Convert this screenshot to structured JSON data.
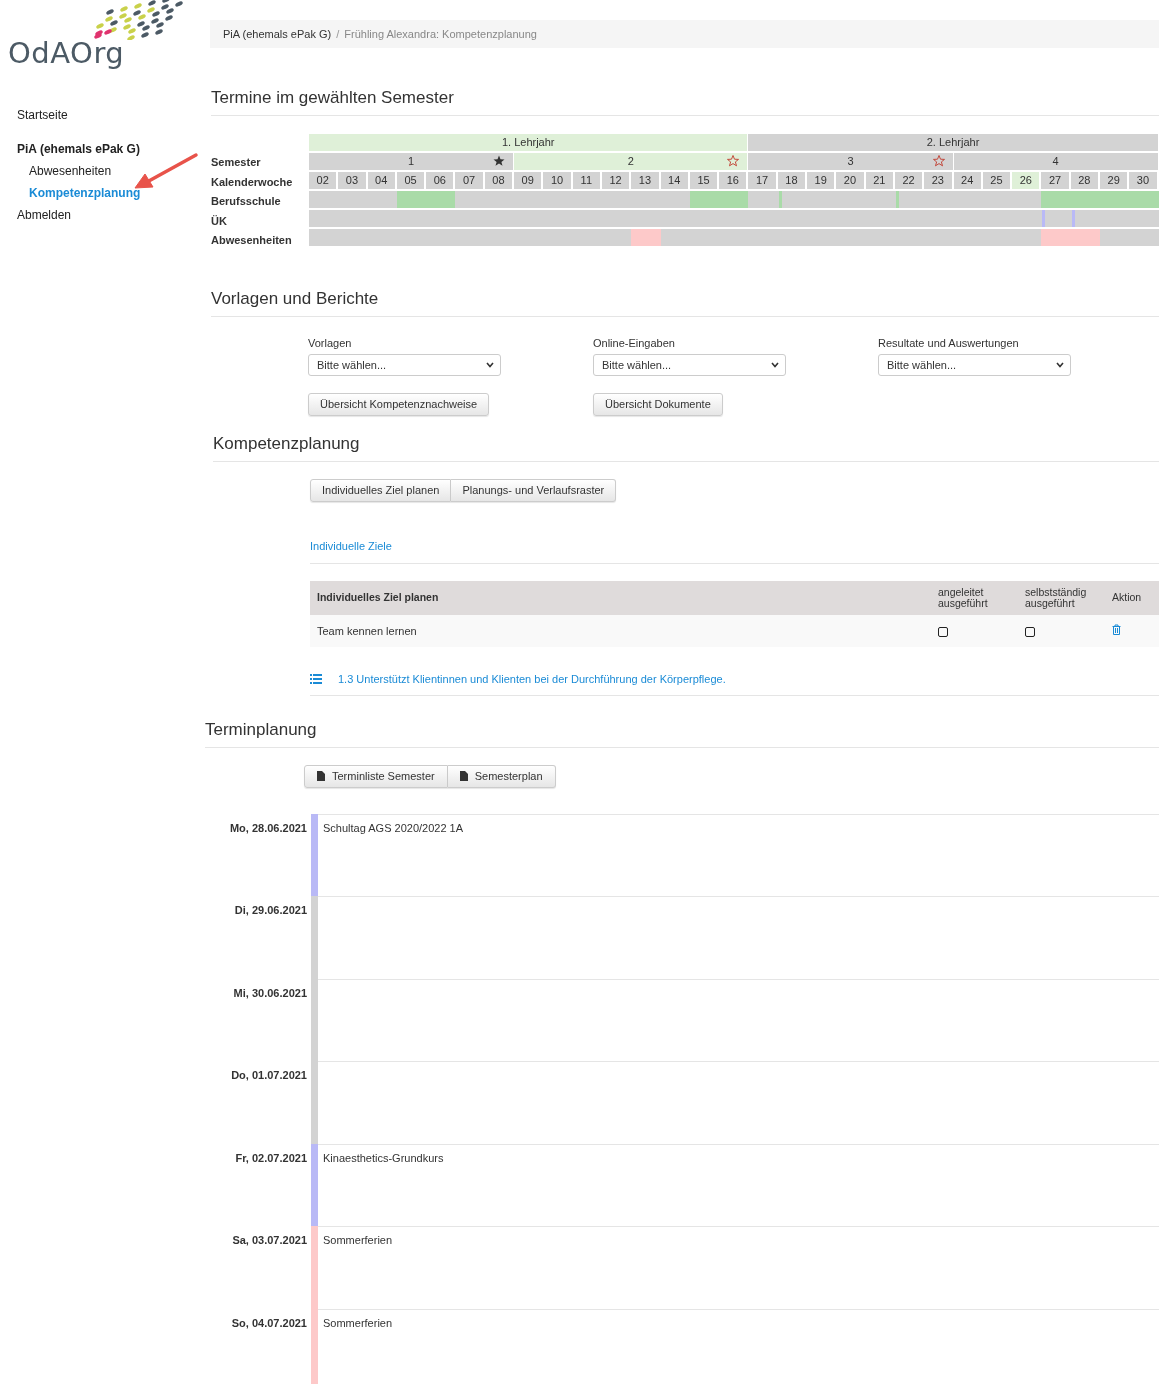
{
  "logo": {
    "text": "OdAOrg"
  },
  "sidebar": {
    "items": [
      {
        "label": "Startseite",
        "selected": false
      },
      {
        "label": "PiA (ehemals ePak G)",
        "selected": false,
        "children": [
          {
            "label": "Abwesenheiten",
            "selected": false
          },
          {
            "label": "Kompetenzplanung",
            "selected": true
          }
        ]
      },
      {
        "label": "Abmelden",
        "selected": false
      }
    ]
  },
  "breadcrumb": [
    {
      "label": "PiA (ehemals ePak G)",
      "kind": "link"
    },
    {
      "label": "/",
      "kind": "separator"
    },
    {
      "label": "Frühling Alexandra: Kompetenzplanung",
      "kind": "current"
    }
  ],
  "timeline": {
    "title": "Termine im gewählten Semester",
    "row_labels": [
      "Semester",
      "Kalenderwoche",
      "Berufsschule",
      "ÜK",
      "Abwesenheiten"
    ],
    "lehrjahre": [
      {
        "label": "1. Lehrjahr",
        "current": true,
        "semesters": [
          {
            "label": "1",
            "current": false,
            "starred": true,
            "star_filled": true,
            "weeks": [
              {
                "label": "02",
                "current": false,
                "school": false,
                "school_mark": false,
                "uek_mark": false,
                "absent": false
              },
              {
                "label": "03",
                "current": false,
                "school": false,
                "school_mark": false,
                "uek_mark": false,
                "absent": false
              },
              {
                "label": "04",
                "current": false,
                "school": false,
                "school_mark": false,
                "uek_mark": false,
                "absent": false
              },
              {
                "label": "05",
                "current": false,
                "school": true,
                "school_mark": false,
                "uek_mark": false,
                "absent": false
              },
              {
                "label": "06",
                "current": false,
                "school": true,
                "school_mark": false,
                "uek_mark": false,
                "absent": false
              },
              {
                "label": "07",
                "current": false,
                "school": false,
                "school_mark": false,
                "uek_mark": false,
                "absent": false
              },
              {
                "label": "08",
                "current": false,
                "school": false,
                "school_mark": false,
                "uek_mark": false,
                "absent": false
              }
            ]
          },
          {
            "label": "2",
            "current": true,
            "starred": true,
            "star_filled": false,
            "weeks": [
              {
                "label": "09",
                "current": false,
                "school": false,
                "school_mark": false,
                "uek_mark": false,
                "absent": false
              },
              {
                "label": "10",
                "current": false,
                "school": false,
                "school_mark": false,
                "uek_mark": false,
                "absent": false
              },
              {
                "label": "11",
                "current": false,
                "school": false,
                "school_mark": false,
                "uek_mark": false,
                "absent": false
              },
              {
                "label": "12",
                "current": false,
                "school": false,
                "school_mark": false,
                "uek_mark": false,
                "absent": false
              },
              {
                "label": "13",
                "current": false,
                "school": false,
                "school_mark": false,
                "uek_mark": false,
                "absent": true
              },
              {
                "label": "14",
                "current": false,
                "school": false,
                "school_mark": false,
                "uek_mark": false,
                "absent": false
              },
              {
                "label": "15",
                "current": false,
                "school": true,
                "school_mark": false,
                "uek_mark": false,
                "absent": false
              },
              {
                "label": "16",
                "current": false,
                "school": true,
                "school_mark": false,
                "uek_mark": false,
                "absent": false
              }
            ]
          }
        ]
      },
      {
        "label": "2. Lehrjahr",
        "current": false,
        "semesters": [
          {
            "label": "3",
            "current": false,
            "starred": true,
            "star_filled": false,
            "weeks": [
              {
                "label": "17",
                "current": false,
                "school": false,
                "school_mark": false,
                "uek_mark": false,
                "absent": false
              },
              {
                "label": "18",
                "current": false,
                "school": false,
                "school_mark": true,
                "uek_mark": false,
                "absent": false
              },
              {
                "label": "19",
                "current": false,
                "school": false,
                "school_mark": false,
                "uek_mark": false,
                "absent": false
              },
              {
                "label": "20",
                "current": false,
                "school": false,
                "school_mark": false,
                "uek_mark": false,
                "absent": false
              },
              {
                "label": "21",
                "current": false,
                "school": false,
                "school_mark": false,
                "uek_mark": false,
                "absent": false
              },
              {
                "label": "22",
                "current": false,
                "school": false,
                "school_mark": true,
                "uek_mark": false,
                "absent": false
              },
              {
                "label": "23",
                "current": false,
                "school": false,
                "school_mark": false,
                "uek_mark": false,
                "absent": false
              }
            ]
          },
          {
            "label": "4",
            "current": false,
            "starred": false,
            "weeks": [
              {
                "label": "24",
                "current": false,
                "school": false,
                "school_mark": false,
                "uek_mark": false,
                "absent": false
              },
              {
                "label": "25",
                "current": false,
                "school": false,
                "school_mark": false,
                "uek_mark": false,
                "absent": false
              },
              {
                "label": "26",
                "current": true,
                "school": false,
                "school_mark": false,
                "uek_mark": false,
                "absent": false
              },
              {
                "label": "27",
                "current": false,
                "school": true,
                "school_mark": false,
                "uek_mark": true,
                "absent": true
              },
              {
                "label": "28",
                "current": false,
                "school": true,
                "school_mark": false,
                "uek_mark": true,
                "absent": true
              },
              {
                "label": "29",
                "current": false,
                "school": true,
                "school_mark": false,
                "uek_mark": false,
                "absent": false
              },
              {
                "label": "30",
                "current": false,
                "school": true,
                "school_mark": false,
                "uek_mark": false,
                "absent": false
              }
            ]
          }
        ]
      }
    ]
  },
  "vorlagen": {
    "title": "Vorlagen und Berichte",
    "selects": [
      {
        "label": "Vorlagen",
        "value": "Bitte wählen..."
      },
      {
        "label": "Online-Eingaben",
        "value": "Bitte wählen..."
      },
      {
        "label": "Resultate und Auswertungen",
        "value": "Bitte wählen..."
      }
    ],
    "buttons": [
      "Übersicht Kompetenznachweise",
      "Übersicht Dokumente"
    ]
  },
  "kompetenzplanung": {
    "title": "Kompetenzplanung",
    "buttons": [
      "Individuelles Ziel planen",
      "Planungs- und Verlaufsraster"
    ],
    "link": "Individuelle Ziele",
    "table": {
      "columns": [
        "Individuelles Ziel planen",
        "angeleitet ausgeführt",
        "selbstständig ausgeführt",
        "Aktion"
      ],
      "rows": [
        {
          "goal": "Team kennen lernen",
          "guided": false,
          "independent": false
        }
      ]
    },
    "competence_link": "1.3 Unterstützt Klientinnen und Klienten bei der Durchführung der Körperpflege."
  },
  "terminplanung": {
    "title": "Terminplanung",
    "buttons": [
      "Terminliste Semester",
      "Semesterplan"
    ],
    "days": [
      {
        "date": "Mo, 28.06.2021",
        "kind": "event",
        "event": "Schultag AGS 2020/2022 1A"
      },
      {
        "date": "Di, 29.06.2021",
        "kind": "empty"
      },
      {
        "date": "Mi, 30.06.2021",
        "kind": "empty"
      },
      {
        "date": "Do, 01.07.2021",
        "kind": "empty"
      },
      {
        "date": "Fr, 02.07.2021",
        "kind": "event",
        "event": "Kinaesthetics-Grundkurs"
      },
      {
        "date": "Sa, 03.07.2021",
        "kind": "holiday",
        "event": "Sommerferien"
      },
      {
        "date": "So, 04.07.2021",
        "kind": "holiday",
        "event": "Sommerferien"
      }
    ]
  }
}
